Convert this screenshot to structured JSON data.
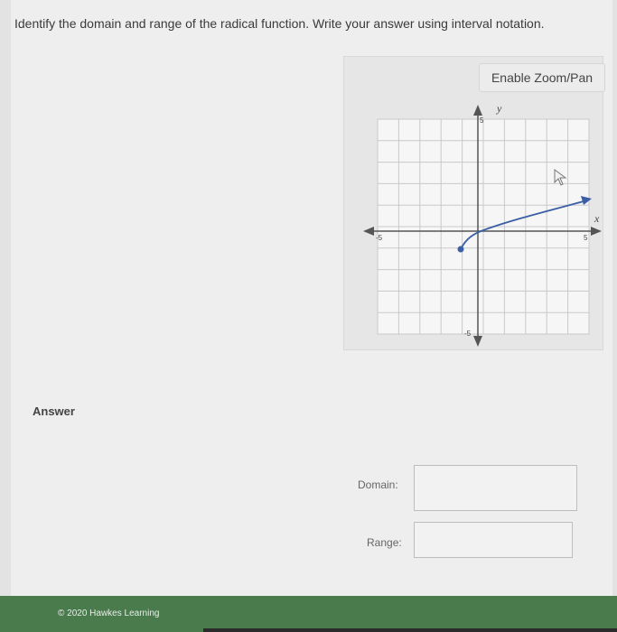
{
  "question": {
    "text": "Identify the domain and range of the radical function. Write your answer using interval notation."
  },
  "graph": {
    "zoom_button_label": "Enable Zoom/Pan",
    "x_axis_label": "x",
    "y_axis_label": "y",
    "tick_labels": {
      "y_top": "5",
      "y_bottom": "-5",
      "x_left": "-5",
      "x_right": "5"
    },
    "curve_color": "#3b5fa5",
    "grid_color": "#c9c9c9"
  },
  "answer": {
    "label": "Answer",
    "domain_label": "Domain:",
    "range_label": "Range:",
    "domain_value": "",
    "range_value": ""
  },
  "footer": {
    "copyright": "© 2020 Hawkes Learning"
  }
}
